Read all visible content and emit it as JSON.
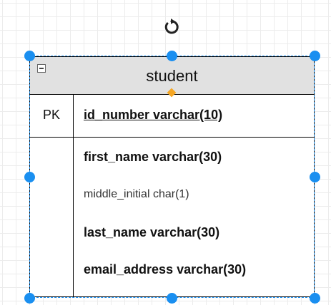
{
  "table": {
    "title": "student",
    "pk_label": "PK",
    "pk_field": "id_number varchar(10)",
    "fields": [
      {
        "text": "first_name varchar(30)",
        "bold": true
      },
      {
        "text": "middle_initial char(1)",
        "bold": false
      },
      {
        "text": "last_name varchar(30)",
        "bold": true
      },
      {
        "text": "email_address varchar(30)",
        "bold": true
      }
    ]
  },
  "colors": {
    "selection": "#1a8ff0",
    "title_bar": "#e1e1e1",
    "constraint_handle": "#f5a623"
  },
  "icons": {
    "rotate": "rotate-icon",
    "collapse": "collapse-minus-icon"
  }
}
